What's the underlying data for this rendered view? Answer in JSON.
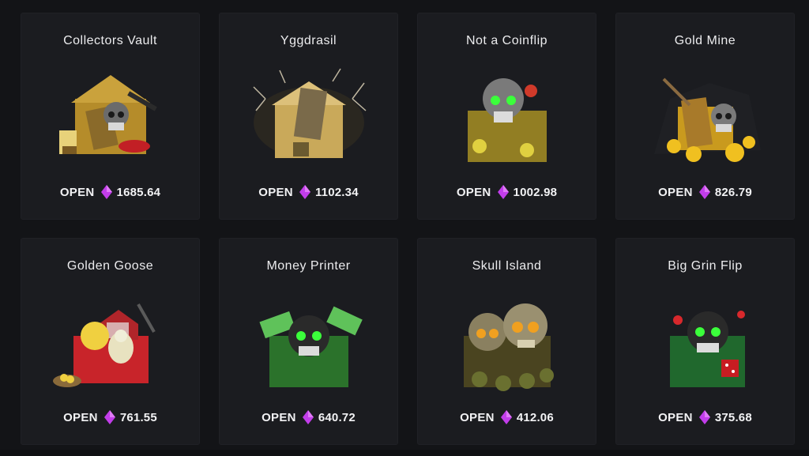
{
  "open_label": "OPEN",
  "currency_icon": "purple-gem-icon",
  "cases": [
    {
      "name": "Collectors Vault",
      "price": "1685.64",
      "icon": "collectors-vault-case-icon",
      "accent": "#d9b64a"
    },
    {
      "name": "Yggdrasil",
      "price": "1102.34",
      "icon": "yggdrasil-case-icon",
      "accent": "#e2c46a"
    },
    {
      "name": "Not a Coinflip",
      "price": "1002.98",
      "icon": "not-a-coinflip-case-icon",
      "accent": "#5ed13a"
    },
    {
      "name": "Gold Mine",
      "price": "826.79",
      "icon": "gold-mine-case-icon",
      "accent": "#e8b820"
    },
    {
      "name": "Golden Goose",
      "price": "761.55",
      "icon": "golden-goose-case-icon",
      "accent": "#d8282c"
    },
    {
      "name": "Money Printer",
      "price": "640.72",
      "icon": "money-printer-case-icon",
      "accent": "#34c24a"
    },
    {
      "name": "Skull Island",
      "price": "412.06",
      "icon": "skull-island-case-icon",
      "accent": "#c9a640"
    },
    {
      "name": "Big Grin Flip",
      "price": "375.68",
      "icon": "big-grin-flip-case-icon",
      "accent": "#2fbf4a"
    }
  ],
  "colors": {
    "background": "#131417",
    "card": "#1b1c20",
    "gem": "#c23dea"
  }
}
